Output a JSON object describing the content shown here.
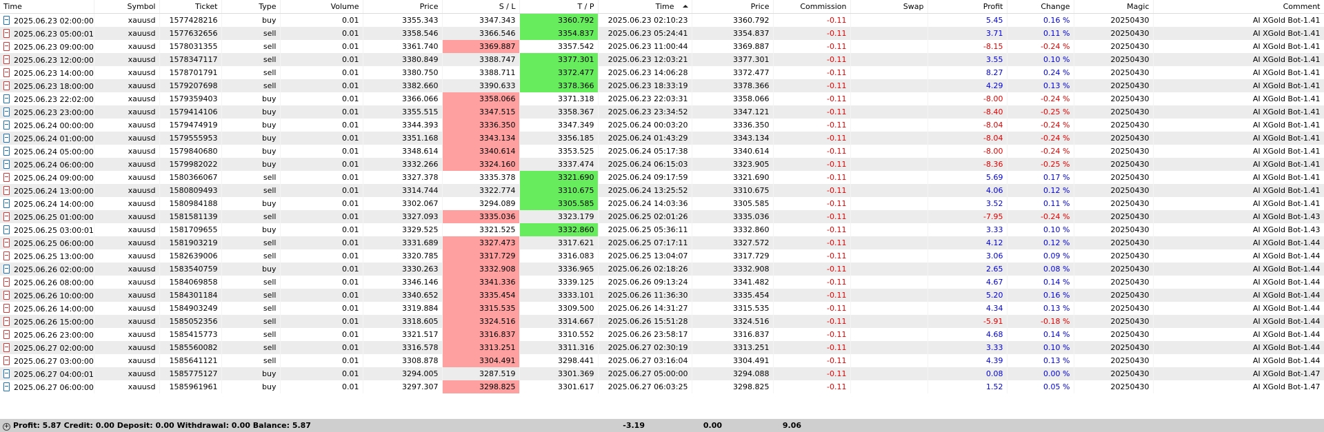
{
  "columns": [
    "Time",
    "Symbol",
    "Ticket",
    "Type",
    "Volume",
    "Price",
    "S / L",
    "T / P",
    "Time",
    "Price",
    "Commission",
    "Swap",
    "Profit",
    "Change",
    "Magic",
    "Comment"
  ],
  "rows": [
    {
      "time": "2025.06.23 02:00:00",
      "symbol": "xauusd",
      "ticket": "1577428216",
      "type": "buy",
      "volume": "0.01",
      "price": "3355.343",
      "sl": "3347.343",
      "tp": "3360.792",
      "close_time": "2025.06.23 02:10:23",
      "close_price": "3360.792",
      "commission": "-0.11",
      "swap": "",
      "profit": "5.45",
      "change": "0.16 %",
      "magic": "20250430",
      "comment": "AI XGold Bot-1.41",
      "hit": "tp"
    },
    {
      "time": "2025.06.23 05:00:01",
      "symbol": "xauusd",
      "ticket": "1577632656",
      "type": "sell",
      "volume": "0.01",
      "price": "3358.546",
      "sl": "3366.546",
      "tp": "3354.837",
      "close_time": "2025.06.23 05:24:41",
      "close_price": "3354.837",
      "commission": "-0.11",
      "swap": "",
      "profit": "3.71",
      "change": "0.11 %",
      "magic": "20250430",
      "comment": "AI XGold Bot-1.41",
      "hit": "tp"
    },
    {
      "time": "2025.06.23 09:00:00",
      "symbol": "xauusd",
      "ticket": "1578031355",
      "type": "sell",
      "volume": "0.01",
      "price": "3361.740",
      "sl": "3369.887",
      "tp": "3357.542",
      "close_time": "2025.06.23 11:00:44",
      "close_price": "3369.887",
      "commission": "-0.11",
      "swap": "",
      "profit": "-8.15",
      "change": "-0.24 %",
      "magic": "20250430",
      "comment": "AI XGold Bot-1.41",
      "hit": "sl"
    },
    {
      "time": "2025.06.23 12:00:00",
      "symbol": "xauusd",
      "ticket": "1578347117",
      "type": "sell",
      "volume": "0.01",
      "price": "3380.849",
      "sl": "3388.747",
      "tp": "3377.301",
      "close_time": "2025.06.23 12:03:21",
      "close_price": "3377.301",
      "commission": "-0.11",
      "swap": "",
      "profit": "3.55",
      "change": "0.10 %",
      "magic": "20250430",
      "comment": "AI XGold Bot-1.41",
      "hit": "tp"
    },
    {
      "time": "2025.06.23 14:00:00",
      "symbol": "xauusd",
      "ticket": "1578701791",
      "type": "sell",
      "volume": "0.01",
      "price": "3380.750",
      "sl": "3388.711",
      "tp": "3372.477",
      "close_time": "2025.06.23 14:06:28",
      "close_price": "3372.477",
      "commission": "-0.11",
      "swap": "",
      "profit": "8.27",
      "change": "0.24 %",
      "magic": "20250430",
      "comment": "AI XGold Bot-1.41",
      "hit": "tp"
    },
    {
      "time": "2025.06.23 18:00:00",
      "symbol": "xauusd",
      "ticket": "1579207698",
      "type": "sell",
      "volume": "0.01",
      "price": "3382.660",
      "sl": "3390.633",
      "tp": "3378.366",
      "close_time": "2025.06.23 18:33:19",
      "close_price": "3378.366",
      "commission": "-0.11",
      "swap": "",
      "profit": "4.29",
      "change": "0.13 %",
      "magic": "20250430",
      "comment": "AI XGold Bot-1.41",
      "hit": "tp"
    },
    {
      "time": "2025.06.23 22:02:00",
      "symbol": "xauusd",
      "ticket": "1579359403",
      "type": "buy",
      "volume": "0.01",
      "price": "3366.066",
      "sl": "3358.066",
      "tp": "3371.318",
      "close_time": "2025.06.23 22:03:31",
      "close_price": "3358.066",
      "commission": "-0.11",
      "swap": "",
      "profit": "-8.00",
      "change": "-0.24 %",
      "magic": "20250430",
      "comment": "AI XGold Bot-1.41",
      "hit": "sl"
    },
    {
      "time": "2025.06.23 23:00:00",
      "symbol": "xauusd",
      "ticket": "1579414106",
      "type": "buy",
      "volume": "0.01",
      "price": "3355.515",
      "sl": "3347.515",
      "tp": "3358.367",
      "close_time": "2025.06.23 23:34:52",
      "close_price": "3347.121",
      "commission": "-0.11",
      "swap": "",
      "profit": "-8.40",
      "change": "-0.25 %",
      "magic": "20250430",
      "comment": "AI XGold Bot-1.41",
      "hit": "sl"
    },
    {
      "time": "2025.06.24 00:00:00",
      "symbol": "xauusd",
      "ticket": "1579474919",
      "type": "buy",
      "volume": "0.01",
      "price": "3344.393",
      "sl": "3336.350",
      "tp": "3347.349",
      "close_time": "2025.06.24 00:03:20",
      "close_price": "3336.350",
      "commission": "-0.11",
      "swap": "",
      "profit": "-8.04",
      "change": "-0.24 %",
      "magic": "20250430",
      "comment": "AI XGold Bot-1.41",
      "hit": "sl"
    },
    {
      "time": "2025.06.24 01:00:00",
      "symbol": "xauusd",
      "ticket": "1579555953",
      "type": "buy",
      "volume": "0.01",
      "price": "3351.168",
      "sl": "3343.134",
      "tp": "3356.185",
      "close_time": "2025.06.24 01:43:29",
      "close_price": "3343.134",
      "commission": "-0.11",
      "swap": "",
      "profit": "-8.04",
      "change": "-0.24 %",
      "magic": "20250430",
      "comment": "AI XGold Bot-1.41",
      "hit": "sl"
    },
    {
      "time": "2025.06.24 05:00:00",
      "symbol": "xauusd",
      "ticket": "1579840680",
      "type": "buy",
      "volume": "0.01",
      "price": "3348.614",
      "sl": "3340.614",
      "tp": "3353.525",
      "close_time": "2025.06.24 05:17:38",
      "close_price": "3340.614",
      "commission": "-0.11",
      "swap": "",
      "profit": "-8.00",
      "change": "-0.24 %",
      "magic": "20250430",
      "comment": "AI XGold Bot-1.41",
      "hit": "sl"
    },
    {
      "time": "2025.06.24 06:00:00",
      "symbol": "xauusd",
      "ticket": "1579982022",
      "type": "buy",
      "volume": "0.01",
      "price": "3332.266",
      "sl": "3324.160",
      "tp": "3337.474",
      "close_time": "2025.06.24 06:15:03",
      "close_price": "3323.905",
      "commission": "-0.11",
      "swap": "",
      "profit": "-8.36",
      "change": "-0.25 %",
      "magic": "20250430",
      "comment": "AI XGold Bot-1.41",
      "hit": "sl"
    },
    {
      "time": "2025.06.24 09:00:00",
      "symbol": "xauusd",
      "ticket": "1580366067",
      "type": "sell",
      "volume": "0.01",
      "price": "3327.378",
      "sl": "3335.378",
      "tp": "3321.690",
      "close_time": "2025.06.24 09:17:59",
      "close_price": "3321.690",
      "commission": "-0.11",
      "swap": "",
      "profit": "5.69",
      "change": "0.17 %",
      "magic": "20250430",
      "comment": "AI XGold Bot-1.41",
      "hit": "tp"
    },
    {
      "time": "2025.06.24 13:00:00",
      "symbol": "xauusd",
      "ticket": "1580809493",
      "type": "sell",
      "volume": "0.01",
      "price": "3314.744",
      "sl": "3322.774",
      "tp": "3310.675",
      "close_time": "2025.06.24 13:25:52",
      "close_price": "3310.675",
      "commission": "-0.11",
      "swap": "",
      "profit": "4.06",
      "change": "0.12 %",
      "magic": "20250430",
      "comment": "AI XGold Bot-1.41",
      "hit": "tp"
    },
    {
      "time": "2025.06.24 14:00:00",
      "symbol": "xauusd",
      "ticket": "1580984188",
      "type": "buy",
      "volume": "0.01",
      "price": "3302.067",
      "sl": "3294.089",
      "tp": "3305.585",
      "close_time": "2025.06.24 14:03:36",
      "close_price": "3305.585",
      "commission": "-0.11",
      "swap": "",
      "profit": "3.52",
      "change": "0.11 %",
      "magic": "20250430",
      "comment": "AI XGold Bot-1.41",
      "hit": "tp"
    },
    {
      "time": "2025.06.25 01:00:00",
      "symbol": "xauusd",
      "ticket": "1581581139",
      "type": "sell",
      "volume": "0.01",
      "price": "3327.093",
      "sl": "3335.036",
      "tp": "3323.179",
      "close_time": "2025.06.25 02:01:26",
      "close_price": "3335.036",
      "commission": "-0.11",
      "swap": "",
      "profit": "-7.95",
      "change": "-0.24 %",
      "magic": "20250430",
      "comment": "AI XGold Bot-1.43",
      "hit": "sl"
    },
    {
      "time": "2025.06.25 03:00:01",
      "symbol": "xauusd",
      "ticket": "1581709655",
      "type": "buy",
      "volume": "0.01",
      "price": "3329.525",
      "sl": "3321.525",
      "tp": "3332.860",
      "close_time": "2025.06.25 05:36:11",
      "close_price": "3332.860",
      "commission": "-0.11",
      "swap": "",
      "profit": "3.33",
      "change": "0.10 %",
      "magic": "20250430",
      "comment": "AI XGold Bot-1.43",
      "hit": "tp"
    },
    {
      "time": "2025.06.25 06:00:00",
      "symbol": "xauusd",
      "ticket": "1581903219",
      "type": "sell",
      "volume": "0.01",
      "price": "3331.689",
      "sl": "3327.473",
      "tp": "3317.621",
      "close_time": "2025.06.25 07:17:11",
      "close_price": "3327.572",
      "commission": "-0.11",
      "swap": "",
      "profit": "4.12",
      "change": "0.12 %",
      "magic": "20250430",
      "comment": "AI XGold Bot-1.44",
      "hit": "sl"
    },
    {
      "time": "2025.06.25 13:00:00",
      "symbol": "xauusd",
      "ticket": "1582639006",
      "type": "sell",
      "volume": "0.01",
      "price": "3320.785",
      "sl": "3317.729",
      "tp": "3316.083",
      "close_time": "2025.06.25 13:04:07",
      "close_price": "3317.729",
      "commission": "-0.11",
      "swap": "",
      "profit": "3.06",
      "change": "0.09 %",
      "magic": "20250430",
      "comment": "AI XGold Bot-1.44",
      "hit": "sl"
    },
    {
      "time": "2025.06.26 02:00:00",
      "symbol": "xauusd",
      "ticket": "1583540759",
      "type": "buy",
      "volume": "0.01",
      "price": "3330.263",
      "sl": "3332.908",
      "tp": "3336.965",
      "close_time": "2025.06.26 02:18:26",
      "close_price": "3332.908",
      "commission": "-0.11",
      "swap": "",
      "profit": "2.65",
      "change": "0.08 %",
      "magic": "20250430",
      "comment": "AI XGold Bot-1.44",
      "hit": "sl"
    },
    {
      "time": "2025.06.26 08:00:00",
      "symbol": "xauusd",
      "ticket": "1584069858",
      "type": "sell",
      "volume": "0.01",
      "price": "3346.146",
      "sl": "3341.336",
      "tp": "3339.125",
      "close_time": "2025.06.26 09:13:24",
      "close_price": "3341.482",
      "commission": "-0.11",
      "swap": "",
      "profit": "4.67",
      "change": "0.14 %",
      "magic": "20250430",
      "comment": "AI XGold Bot-1.44",
      "hit": "sl"
    },
    {
      "time": "2025.06.26 10:00:00",
      "symbol": "xauusd",
      "ticket": "1584301184",
      "type": "sell",
      "volume": "0.01",
      "price": "3340.652",
      "sl": "3335.454",
      "tp": "3333.101",
      "close_time": "2025.06.26 11:36:30",
      "close_price": "3335.454",
      "commission": "-0.11",
      "swap": "",
      "profit": "5.20",
      "change": "0.16 %",
      "magic": "20250430",
      "comment": "AI XGold Bot-1.44",
      "hit": "sl"
    },
    {
      "time": "2025.06.26 14:00:00",
      "symbol": "xauusd",
      "ticket": "1584903249",
      "type": "sell",
      "volume": "0.01",
      "price": "3319.884",
      "sl": "3315.535",
      "tp": "3309.500",
      "close_time": "2025.06.26 14:31:27",
      "close_price": "3315.535",
      "commission": "-0.11",
      "swap": "",
      "profit": "4.34",
      "change": "0.13 %",
      "magic": "20250430",
      "comment": "AI XGold Bot-1.44",
      "hit": "sl"
    },
    {
      "time": "2025.06.26 15:00:00",
      "symbol": "xauusd",
      "ticket": "1585052356",
      "type": "sell",
      "volume": "0.01",
      "price": "3318.605",
      "sl": "3324.516",
      "tp": "3314.667",
      "close_time": "2025.06.26 15:51:28",
      "close_price": "3324.516",
      "commission": "-0.11",
      "swap": "",
      "profit": "-5.91",
      "change": "-0.18 %",
      "magic": "20250430",
      "comment": "AI XGold Bot-1.44",
      "hit": "sl"
    },
    {
      "time": "2025.06.26 23:00:00",
      "symbol": "xauusd",
      "ticket": "1585415773",
      "type": "sell",
      "volume": "0.01",
      "price": "3321.517",
      "sl": "3316.837",
      "tp": "3310.552",
      "close_time": "2025.06.26 23:58:17",
      "close_price": "3316.837",
      "commission": "-0.11",
      "swap": "",
      "profit": "4.68",
      "change": "0.14 %",
      "magic": "20250430",
      "comment": "AI XGold Bot-1.44",
      "hit": "sl"
    },
    {
      "time": "2025.06.27 02:00:00",
      "symbol": "xauusd",
      "ticket": "1585560082",
      "type": "sell",
      "volume": "0.01",
      "price": "3316.578",
      "sl": "3313.251",
      "tp": "3311.316",
      "close_time": "2025.06.27 02:30:19",
      "close_price": "3313.251",
      "commission": "-0.11",
      "swap": "",
      "profit": "3.33",
      "change": "0.10 %",
      "magic": "20250430",
      "comment": "AI XGold Bot-1.44",
      "hit": "sl"
    },
    {
      "time": "2025.06.27 03:00:00",
      "symbol": "xauusd",
      "ticket": "1585641121",
      "type": "sell",
      "volume": "0.01",
      "price": "3308.878",
      "sl": "3304.491",
      "tp": "3298.441",
      "close_time": "2025.06.27 03:16:04",
      "close_price": "3304.491",
      "commission": "-0.11",
      "swap": "",
      "profit": "4.39",
      "change": "0.13 %",
      "magic": "20250430",
      "comment": "AI XGold Bot-1.44",
      "hit": "sl"
    },
    {
      "time": "2025.06.27 04:00:01",
      "symbol": "xauusd",
      "ticket": "1585775127",
      "type": "buy",
      "volume": "0.01",
      "price": "3294.005",
      "sl": "3287.519",
      "tp": "3301.369",
      "close_time": "2025.06.27 05:00:00",
      "close_price": "3294.088",
      "commission": "-0.11",
      "swap": "",
      "profit": "0.08",
      "change": "0.00 %",
      "magic": "20250430",
      "comment": "AI XGold Bot-1.47",
      "hit": ""
    },
    {
      "time": "2025.06.27 06:00:00",
      "symbol": "xauusd",
      "ticket": "1585961961",
      "type": "buy",
      "volume": "0.01",
      "price": "3297.307",
      "sl": "3298.825",
      "tp": "3301.617",
      "close_time": "2025.06.27 06:03:25",
      "close_price": "3298.825",
      "commission": "-0.11",
      "swap": "",
      "profit": "1.52",
      "change": "0.05 %",
      "magic": "20250430",
      "comment": "AI XGold Bot-1.47",
      "hit": "sl"
    }
  ],
  "summary": {
    "stats": "Profit: 5.87  Credit: 0.00  Deposit: 0.00  Withdrawal: 0.00  Balance: 5.87",
    "commission_total": "-3.19",
    "swap_total": "0.00",
    "profit_total": "9.06"
  },
  "colors": {
    "sl_hit": "#ffa0a0",
    "tp_hit": "#67ec5d",
    "negative": "#e00000",
    "positive": "#0000d8",
    "summary_bg": "#cfcfcf"
  },
  "icons": {
    "buy": "trade-buy-icon",
    "sell": "trade-sell-icon",
    "summary": "plus-circle-icon"
  }
}
